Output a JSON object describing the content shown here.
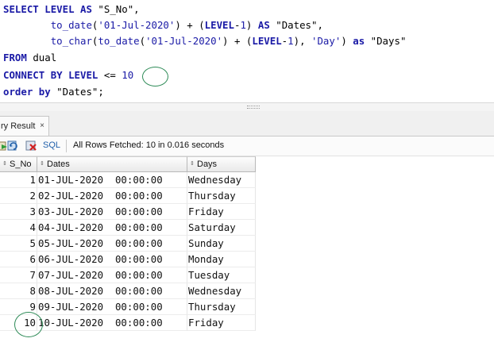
{
  "editor": {
    "line1": {
      "kw1": "SELECT",
      "kw2": "LEVEL",
      "kw3": "AS",
      "alias": "\"S_No\","
    },
    "line2": {
      "fn": "to_date",
      "open": "(",
      "str": "'01-Jul-2020'",
      "mid": ") + (",
      "kw": "LEVEL",
      "minus": "-",
      "num": "1",
      "close": ")",
      "as": "AS",
      "alias": "\"Dates\","
    },
    "line3": {
      "fn1": "to_char",
      "open1": "(",
      "fn2": "to_date",
      "open2": "(",
      "str1": "'01-Jul-2020'",
      "mid": ") + (",
      "kw": "LEVEL",
      "minus": "-",
      "num": "1",
      "close": "), ",
      "str2": "'Day'",
      "close2": ")",
      "as": "as",
      "alias": "\"Days\""
    },
    "line4": {
      "kw": "FROM",
      "tbl": "dual"
    },
    "line5": {
      "kw1": "CONNECT",
      "kw2": "BY",
      "kw3": "LEVEL",
      "op": "<=",
      "num": "10"
    },
    "line6": {
      "kw1": "order",
      "kw2": "by",
      "alias": "\"Dates\";"
    }
  },
  "tab": {
    "label": "ry Result",
    "close": "×"
  },
  "toolbar": {
    "sql_label": "SQL",
    "status": "All Rows Fetched: 10 in 0.016 seconds"
  },
  "grid": {
    "columns": [
      "S_No",
      "Dates",
      "Days"
    ],
    "rows": [
      {
        "no": "1",
        "date": "01-JUL-2020  00:00:00",
        "day": "Wednesday"
      },
      {
        "no": "2",
        "date": "02-JUL-2020  00:00:00",
        "day": "Thursday"
      },
      {
        "no": "3",
        "date": "03-JUL-2020  00:00:00",
        "day": "Friday"
      },
      {
        "no": "4",
        "date": "04-JUL-2020  00:00:00",
        "day": "Saturday"
      },
      {
        "no": "5",
        "date": "05-JUL-2020  00:00:00",
        "day": "Sunday"
      },
      {
        "no": "6",
        "date": "06-JUL-2020  00:00:00",
        "day": "Monday"
      },
      {
        "no": "7",
        "date": "07-JUL-2020  00:00:00",
        "day": "Tuesday"
      },
      {
        "no": "8",
        "date": "08-JUL-2020  00:00:00",
        "day": "Wednesday"
      },
      {
        "no": "9",
        "date": "09-JUL-2020  00:00:00",
        "day": "Thursday"
      },
      {
        "no": "10",
        "date": "10-JUL-2020  00:00:00",
        "day": "Friday"
      }
    ]
  },
  "colors": {
    "keyword": "#1a1aa6",
    "annotation": "#2e8b57"
  }
}
